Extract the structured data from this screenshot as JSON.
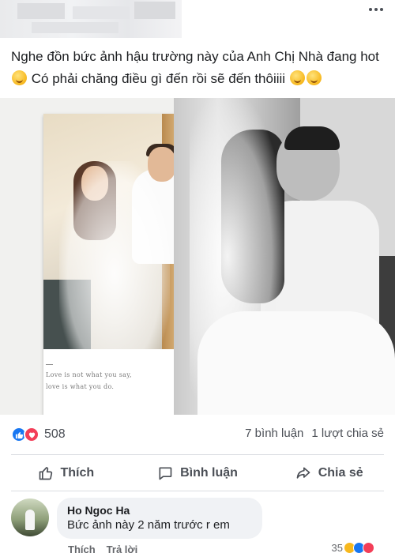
{
  "post": {
    "text_1": "Nghe đồn bức ảnh hậu trường này của Anh Chị Nhà đang hot",
    "text_2": "Có phải chăng điều gì đến rồi sẽ đến thôiiii",
    "photo_quote_1": "Love is not what you say,",
    "photo_quote_2": "love is what you do."
  },
  "stats": {
    "reaction_count": "508",
    "comments": "7 bình luận",
    "shares": "1 lượt chia sẻ"
  },
  "actions": {
    "like": "Thích",
    "comment": "Bình luận",
    "share": "Chia sẻ"
  },
  "comment": {
    "author": "Ho Ngoc Ha",
    "text": "Bức ảnh này 2 năm trước r em",
    "like": "Thích",
    "reply": "Trả lời",
    "reaction_count": "35"
  },
  "icons": {
    "more": "more-horizontal-icon",
    "like": "thumbs-up-icon",
    "comment": "speech-bubble-icon",
    "share": "share-arrow-icon"
  },
  "colors": {
    "like_blue": "#1877f2",
    "love_red": "#f33e58",
    "text_gray": "#4b4f56"
  }
}
